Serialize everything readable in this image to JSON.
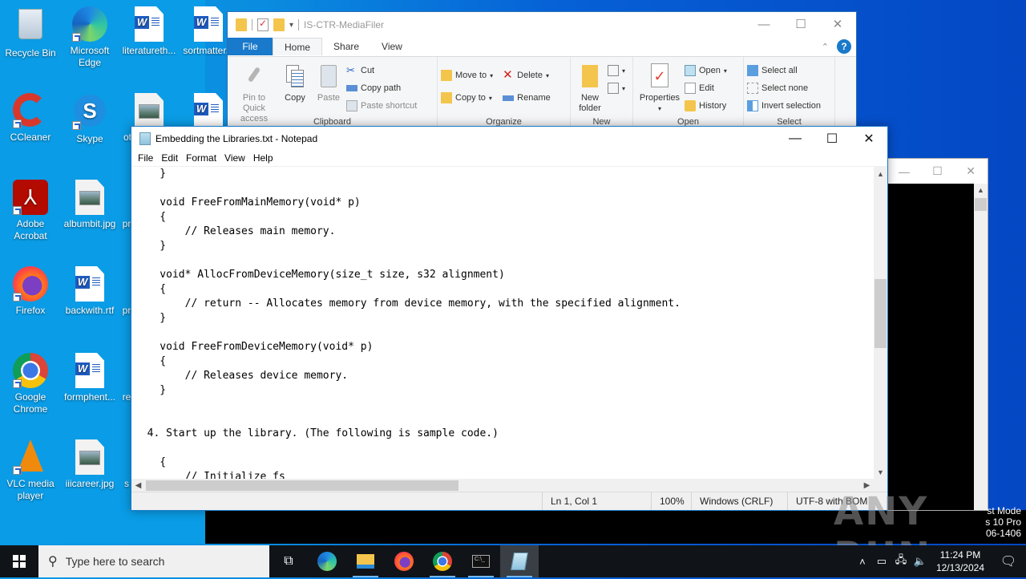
{
  "desktop": {
    "icons": [
      {
        "label": "Recycle Bin",
        "icon": "recycle-bin-icon"
      },
      {
        "label": "Microsoft Edge",
        "icon": "edge-icon"
      },
      {
        "label": "literatureth...",
        "icon": "word-doc-icon"
      },
      {
        "label": "sortmatter...",
        "icon": "word-doc-icon"
      },
      {
        "label": "CCleaner",
        "icon": "ccleaner-icon"
      },
      {
        "label": "Skype",
        "icon": "skype-icon"
      },
      {
        "label": "ot",
        "icon": "image-file-icon"
      },
      {
        "label": "",
        "icon": "word-doc-icon"
      },
      {
        "label": "Adobe Acrobat",
        "icon": "acrobat-icon"
      },
      {
        "label": "albumbit.jpg",
        "icon": "image-file-icon"
      },
      {
        "label": "pr",
        "icon": "file-icon"
      },
      {
        "label": "Firefox",
        "icon": "firefox-icon"
      },
      {
        "label": "backwith.rtf",
        "icon": "word-doc-icon"
      },
      {
        "label": "pr",
        "icon": "file-icon"
      },
      {
        "label": "Google Chrome",
        "icon": "chrome-icon"
      },
      {
        "label": "formphent...",
        "icon": "word-doc-icon"
      },
      {
        "label": "re",
        "icon": "file-icon"
      },
      {
        "label": "VLC media player",
        "icon": "vlc-icon"
      },
      {
        "label": "iiicareer.jpg",
        "icon": "image-file-icon"
      },
      {
        "label": "s",
        "icon": "file-icon"
      }
    ],
    "sysinfo": [
      "st Mode",
      "s 10 Pro",
      "06-1406"
    ],
    "watermark": "ANY RUN"
  },
  "explorer": {
    "title": "IS-CTR-MediaFiler",
    "tabs": [
      "File",
      "Home",
      "Share",
      "View"
    ],
    "active_tab": "Home",
    "groups": {
      "clipboard": {
        "label": "Clipboard",
        "pin": "Pin to Quick access",
        "copy": "Copy",
        "paste": "Paste",
        "cut": "Cut",
        "copy_path": "Copy path",
        "paste_shortcut": "Paste shortcut"
      },
      "organize": {
        "label": "Organize",
        "move_to": "Move to",
        "copy_to": "Copy to",
        "delete": "Delete",
        "rename": "Rename"
      },
      "new": {
        "label": "New",
        "new_folder": "New folder"
      },
      "open": {
        "label": "Open",
        "properties": "Properties",
        "open": "Open",
        "edit": "Edit",
        "history": "History"
      },
      "select": {
        "label": "Select",
        "select_all": "Select all",
        "select_none": "Select none",
        "invert": "Invert selection"
      }
    }
  },
  "notepad": {
    "title": "Embedding the Libraries.txt - Notepad",
    "menu": [
      "File",
      "Edit",
      "Format",
      "View",
      "Help"
    ],
    "lines": [
      "    }",
      "",
      "    void FreeFromMainMemory(void* p)",
      "    {",
      "        // Releases main memory.",
      "    }",
      "",
      "    void* AllocFromDeviceMemory(size_t size, s32 alignment)",
      "    {",
      "        // return -- Allocates memory from device memory, with the specified alignment.",
      "    }",
      "",
      "    void FreeFromDeviceMemory(void* p)",
      "    {",
      "        // Releases device memory.",
      "    }",
      "",
      "",
      "  4. Start up the library. (The following is sample code.)",
      "",
      "    {",
      "        // Initialize fs"
    ],
    "status": {
      "position": "Ln 1, Col 1",
      "zoom": "100%",
      "line_ending": "Windows (CRLF)",
      "encoding": "UTF-8 with BOM"
    }
  },
  "taskbar": {
    "search_placeholder": "Type here to search",
    "apps": [
      "task-view",
      "edge",
      "file-explorer",
      "firefox",
      "chrome",
      "cmd",
      "notepad"
    ],
    "time": "11:24 PM",
    "date": "12/13/2024"
  }
}
